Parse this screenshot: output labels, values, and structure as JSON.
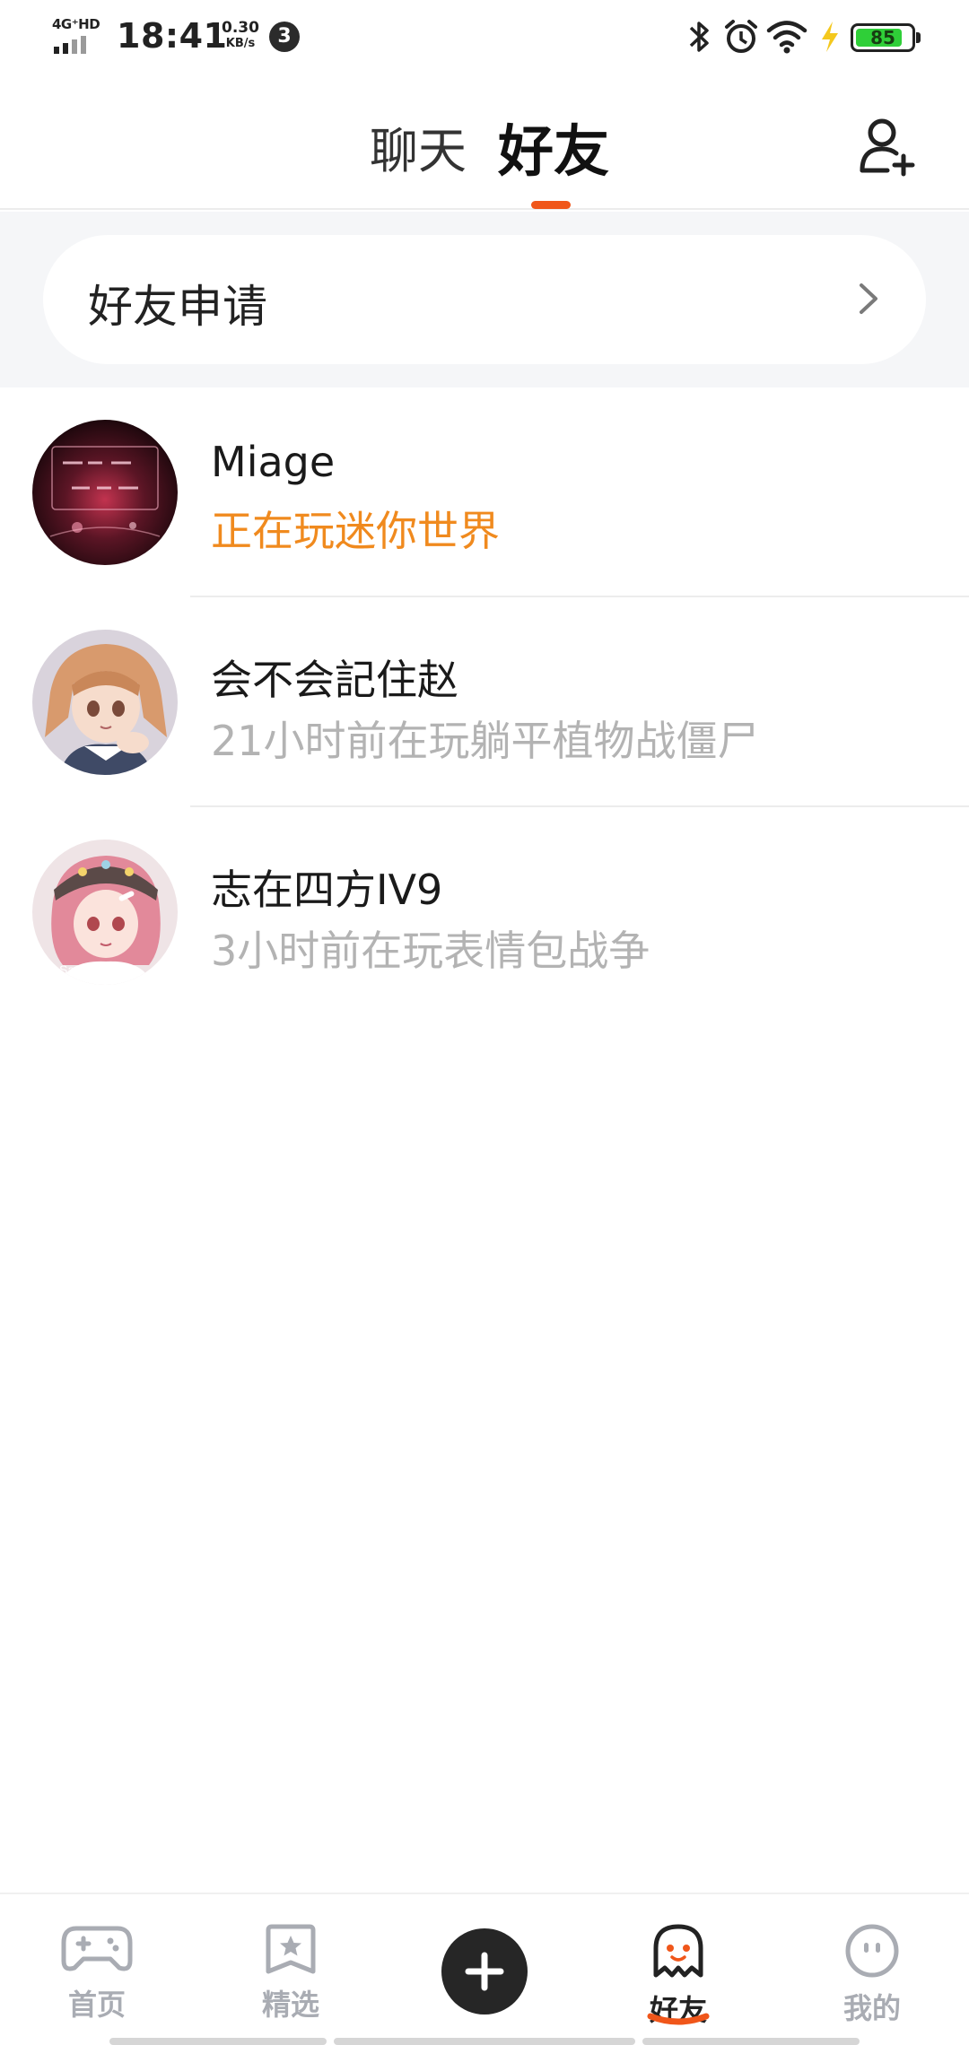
{
  "status_bar": {
    "network": "4G⁺HD",
    "time": "18:41",
    "speed_value": "0.30",
    "speed_unit": "KB/s",
    "notification_count": "3",
    "battery": "85",
    "battery_level": 0.85,
    "icons": [
      "signal-icon",
      "bluetooth-icon",
      "alarm-icon",
      "wifi-icon",
      "charging-icon",
      "battery-icon"
    ]
  },
  "header": {
    "tabs": [
      {
        "label": "聊天",
        "active": false
      },
      {
        "label": "好友",
        "active": true
      }
    ],
    "accent_color": "#f0561a",
    "add_friend_icon": "add-user-icon"
  },
  "friend_request": {
    "label": "好友申请",
    "icon": "chevron-right-icon"
  },
  "friends": [
    {
      "name": "Miage",
      "status": "正在玩迷你世界",
      "online": true
    },
    {
      "name": "会不会記住赵",
      "status": "21小时前在玩躺平植物战僵尸",
      "online": false
    },
    {
      "name": "志在四方IV9",
      "status": "3小时前在玩表情包战争",
      "online": false
    }
  ],
  "bottom_nav": {
    "items": [
      {
        "label": "首页",
        "icon": "gamepad-icon",
        "active": false
      },
      {
        "label": "精选",
        "icon": "star-bookmark-icon",
        "active": false
      },
      {
        "label": "",
        "icon": "plus-icon",
        "active": false
      },
      {
        "label": "好友",
        "icon": "ghost-icon",
        "active": true
      },
      {
        "label": "我的",
        "icon": "smiley-icon",
        "active": false
      }
    ]
  },
  "colors": {
    "online_status": "#f08a1e",
    "offline_status": "#b3b3b3",
    "battery_green": "#2fcf38"
  }
}
